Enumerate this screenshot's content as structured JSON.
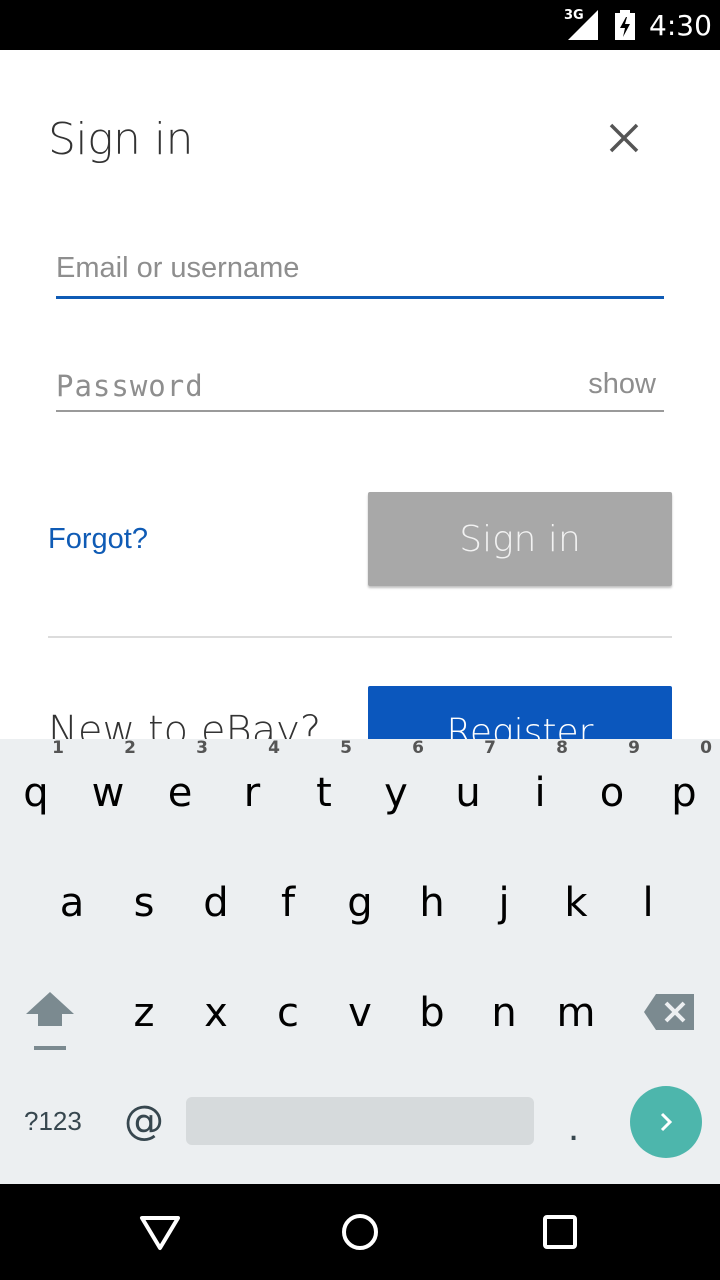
{
  "status_bar": {
    "network": "3G",
    "time": "4:30"
  },
  "dialog": {
    "title": "Sign in",
    "email_placeholder": "Email or username",
    "password_placeholder": "Password",
    "show_label": "show",
    "forgot_label": "Forgot?",
    "signin_label": "Sign in",
    "new_to_label": "New to eBay?",
    "register_label": "Register"
  },
  "keyboard": {
    "row1": [
      {
        "key": "q",
        "hint": "1"
      },
      {
        "key": "w",
        "hint": "2"
      },
      {
        "key": "e",
        "hint": "3"
      },
      {
        "key": "r",
        "hint": "4"
      },
      {
        "key": "t",
        "hint": "5"
      },
      {
        "key": "y",
        "hint": "6"
      },
      {
        "key": "u",
        "hint": "7"
      },
      {
        "key": "i",
        "hint": "8"
      },
      {
        "key": "o",
        "hint": "9"
      },
      {
        "key": "p",
        "hint": "0"
      }
    ],
    "row2": [
      "a",
      "s",
      "d",
      "f",
      "g",
      "h",
      "j",
      "k",
      "l"
    ],
    "row3": [
      "z",
      "x",
      "c",
      "v",
      "b",
      "n",
      "m"
    ],
    "symbols_label": "?123",
    "at_label": "@",
    "period_label": "."
  },
  "icons": {
    "close": "close-icon",
    "shift": "shift-icon",
    "delete": "backspace-icon",
    "go": "chevron-right-icon",
    "back": "back-triangle-icon",
    "home": "home-circle-icon",
    "recents": "recents-square-icon"
  },
  "colors": {
    "accent": "#0f5bb5",
    "register": "#0b57bd",
    "signin_disabled": "#a8a8a8",
    "go_key": "#4db6ac"
  }
}
